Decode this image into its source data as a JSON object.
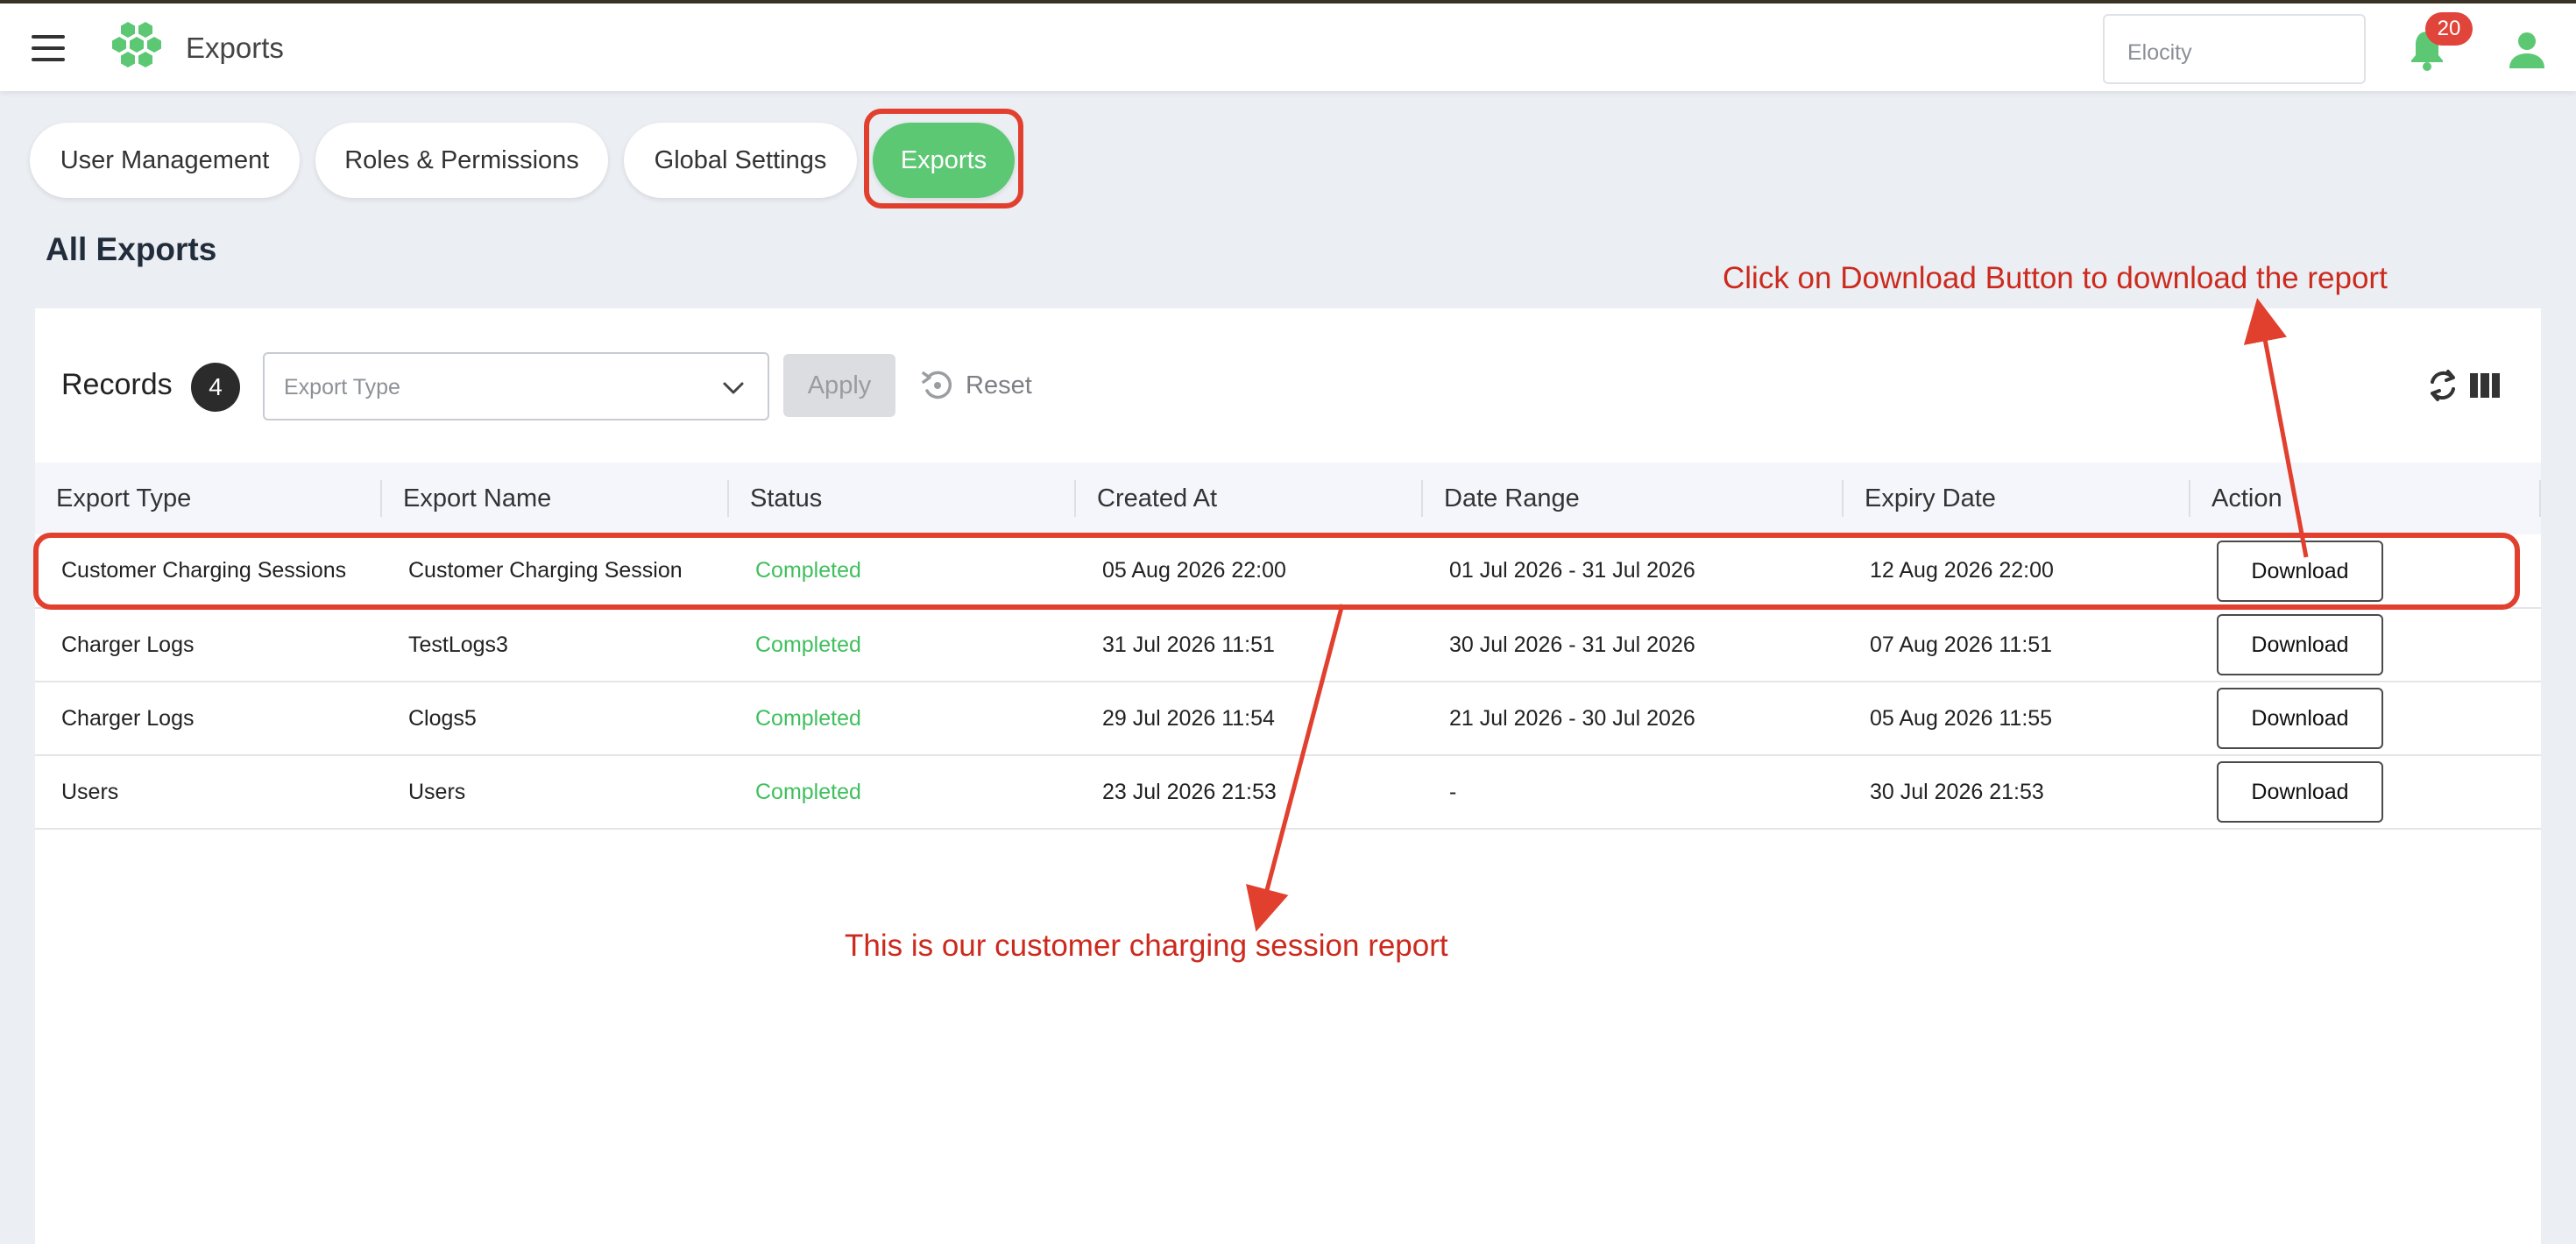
{
  "header": {
    "title": "Exports",
    "org_selector_value": "Elocity",
    "notification_count": "20"
  },
  "tabs": [
    {
      "label": "User Management",
      "active": false
    },
    {
      "label": "Roles & Permissions",
      "active": false
    },
    {
      "label": "Global Settings",
      "active": false
    },
    {
      "label": "Exports",
      "active": true
    }
  ],
  "page": {
    "title": "All Exports"
  },
  "toolbar": {
    "records_label": "Records",
    "records_count": "4",
    "export_type_placeholder": "Export Type",
    "apply_label": "Apply",
    "reset_label": "Reset"
  },
  "table": {
    "columns": [
      "Export Type",
      "Export Name",
      "Status",
      "Created At",
      "Date Range",
      "Expiry Date",
      "Action"
    ],
    "rows": [
      {
        "export_type": "Customer Charging Sessions",
        "export_name": "Customer Charging Session",
        "status": "Completed",
        "created_at": "05 Aug 2026 22:00",
        "date_range": "01 Jul 2026 - 31 Jul 2026",
        "expiry_date": "12 Aug 2026 22:00",
        "action": "Download"
      },
      {
        "export_type": "Charger Logs",
        "export_name": "TestLogs3",
        "status": "Completed",
        "created_at": "31 Jul 2026 11:51",
        "date_range": "30 Jul 2026 - 31 Jul 2026",
        "expiry_date": "07 Aug 2026 11:51",
        "action": "Download"
      },
      {
        "export_type": "Charger Logs",
        "export_name": "Clogs5",
        "status": "Completed",
        "created_at": "29 Jul 2026 11:54",
        "date_range": "21 Jul 2026 - 30 Jul 2026",
        "expiry_date": "05 Aug 2026 11:55",
        "action": "Download"
      },
      {
        "export_type": "Users",
        "export_name": "Users",
        "status": "Completed",
        "created_at": "23 Jul 2026 21:53",
        "date_range": "-",
        "expiry_date": "30 Jul 2026 21:53",
        "action": "Download"
      }
    ]
  },
  "annotations": {
    "download_hint": "Click on Download Button to download the report",
    "row_hint": "This is our customer charging session report"
  },
  "colors": {
    "accent_green": "#5cc873",
    "status_green": "#3fbf5d",
    "annotation_red": "#e2402f",
    "badge_red": "#e0443a"
  },
  "icons": [
    "menu-icon",
    "app-logo",
    "bell-icon",
    "user-icon",
    "chevron-down-icon",
    "reset-icon",
    "refresh-icon",
    "columns-icon"
  ]
}
